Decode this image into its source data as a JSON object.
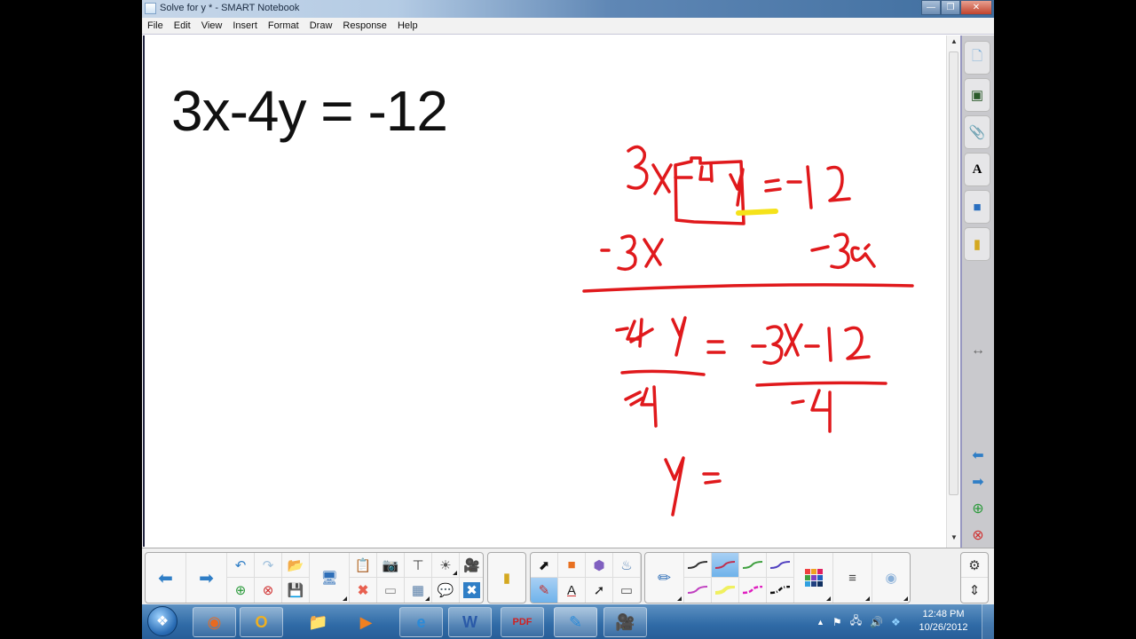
{
  "window": {
    "title": "Solve for y * - SMART Notebook",
    "controls": [
      "minimize",
      "restore",
      "close"
    ]
  },
  "menu": [
    "File",
    "Edit",
    "View",
    "Insert",
    "Format",
    "Draw",
    "Response",
    "Help"
  ],
  "page": {
    "typed_equation": "3x-4y = -12",
    "handwriting_color": "#e0191c",
    "highlight_color": "#f5e21a",
    "handwritten_lines": [
      "3x -4y = -12",
      "-3x        -3x",
      "-4y = -3x-12",
      "-4      -4",
      "y ="
    ],
    "boxed_term": "-4y"
  },
  "side_tabs": [
    {
      "name": "page-sorter",
      "icon": "page-icon"
    },
    {
      "name": "gallery",
      "icon": "image-icon"
    },
    {
      "name": "attachments",
      "icon": "paperclip-icon"
    },
    {
      "name": "properties",
      "icon": "text-properties-icon"
    },
    {
      "name": "add-ons",
      "icon": "puzzle-icon"
    },
    {
      "name": "smart-response",
      "icon": "clicker-icon"
    }
  ],
  "side_buttons": [
    "move-sidebar",
    "previous-page",
    "next-page",
    "add-page",
    "delete-page"
  ],
  "toolbar": {
    "nav": [
      "previous-page",
      "next-page"
    ],
    "edit": [
      "undo",
      "redo",
      "open",
      "add-page",
      "delete-page",
      "save"
    ],
    "display": "screen-display",
    "insert": [
      "paste",
      "screen-capture",
      "document-camera",
      "measurement-tools",
      "video",
      "delete",
      "screen-shade",
      "table",
      "notes",
      "full-screen"
    ],
    "response": "response-clicker",
    "tools": [
      "select",
      "shapes",
      "regular-polygons",
      "fill",
      "pens",
      "text",
      "lines",
      "eraser"
    ],
    "selected_tool": "pens",
    "pen_colors": [
      "#333333",
      "#c03050",
      "#40a040",
      "#5040c0",
      "#c040c0",
      "#f0f060",
      "#e020c0",
      "#111111"
    ],
    "selected_pen_index": 1,
    "more": [
      "color-palette",
      "line-style",
      "transparency"
    ],
    "right": [
      "settings",
      "move-toolbar"
    ]
  },
  "taskbar": {
    "apps": [
      "Firefox",
      "Outlook",
      "Windows Explorer",
      "Media Player",
      "Internet Explorer",
      "Word",
      "Adobe Reader",
      "SMART Notebook",
      "Video Recorder"
    ],
    "time": "12:48 PM",
    "date": "10/26/2012"
  }
}
